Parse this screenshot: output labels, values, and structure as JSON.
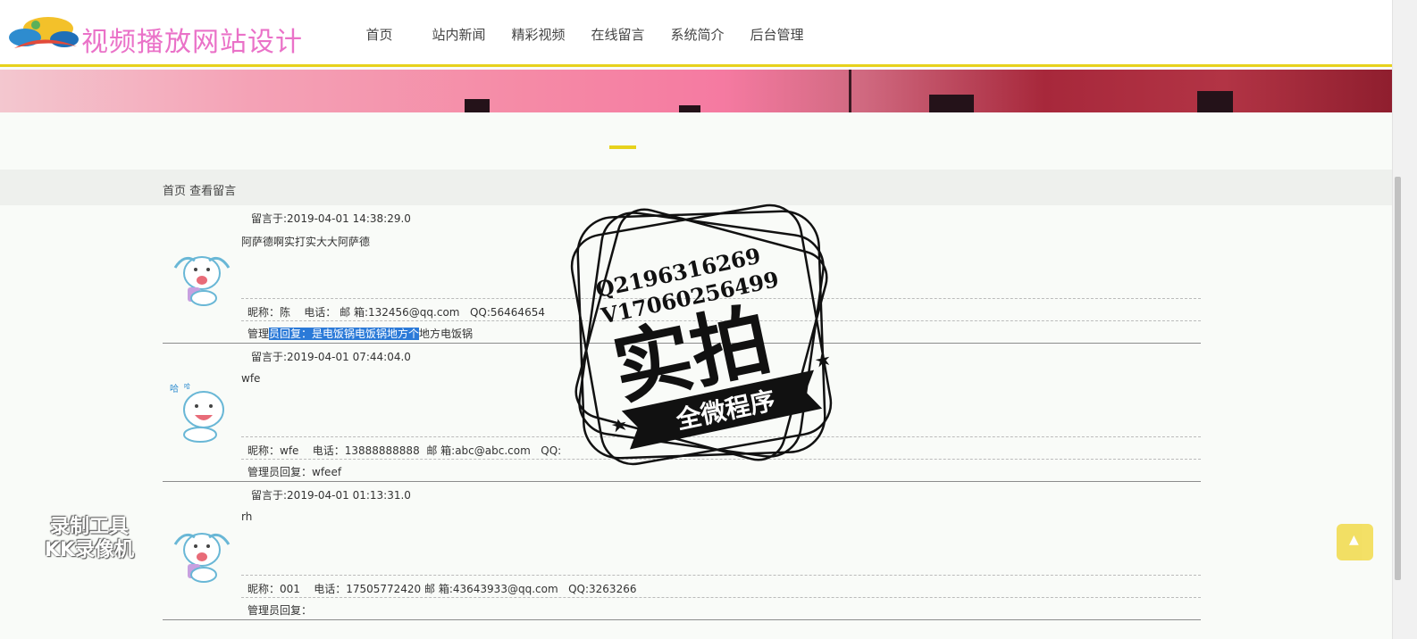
{
  "site": {
    "title": "视频播放网站设计"
  },
  "nav": {
    "items": [
      "首页",
      "站内新闻",
      "精彩视频",
      "在线留言",
      "系统简介",
      "后台管理"
    ]
  },
  "breadcrumb": {
    "home": "首页",
    "current": "查看留言"
  },
  "messages": [
    {
      "time": "留言于:2019-04-01 14:38:29.0",
      "content": "阿萨德啊实打实大大阿萨德",
      "nickname_label": "昵称：",
      "nickname": "陈",
      "phone_label": "电话：",
      "phone": "",
      "email_label": "邮 箱:",
      "email": "132456@qq.com",
      "qq_label": "QQ:",
      "qq": "56464654",
      "reply_prefix": "管理",
      "reply_selected": "员回复：是电饭锅电饭锅地方个",
      "reply_suffix": "地方电饭锅"
    },
    {
      "time": "留言于:2019-04-01 07:44:04.0",
      "content": "wfe",
      "nickname_label": "昵称：",
      "nickname": "wfe",
      "phone_label": "电话：",
      "phone": "13888888888",
      "email_label": "邮 箱:",
      "email": "abc@abc.com",
      "qq_label": "QQ:",
      "qq": "",
      "reply_prefix": "管理员回复：",
      "reply_selected": "",
      "reply_suffix": "wfeef"
    },
    {
      "time": "留言于:2019-04-01 01:13:31.0",
      "content": "rh",
      "nickname_label": "昵称：",
      "nickname": "001",
      "phone_label": "电话：",
      "phone": "17505772420",
      "email_label": "邮 箱:",
      "email": "43643933@qq.com",
      "qq_label": "QQ:",
      "qq": "3263266",
      "reply_prefix": "管理员回复：",
      "reply_selected": "",
      "reply_suffix": ""
    }
  ],
  "watermark": {
    "stamp_line1": "Q2196316269",
    "stamp_line2": "V17060256499",
    "stamp_main": "实拍",
    "stamp_banner": "全微程序",
    "recorder_line1": "录制工具",
    "recorder_line2": "KK录像机"
  },
  "colors": {
    "accent": "#e7d21c",
    "title": "#ea72c8",
    "selection": "#2b7ad8"
  }
}
